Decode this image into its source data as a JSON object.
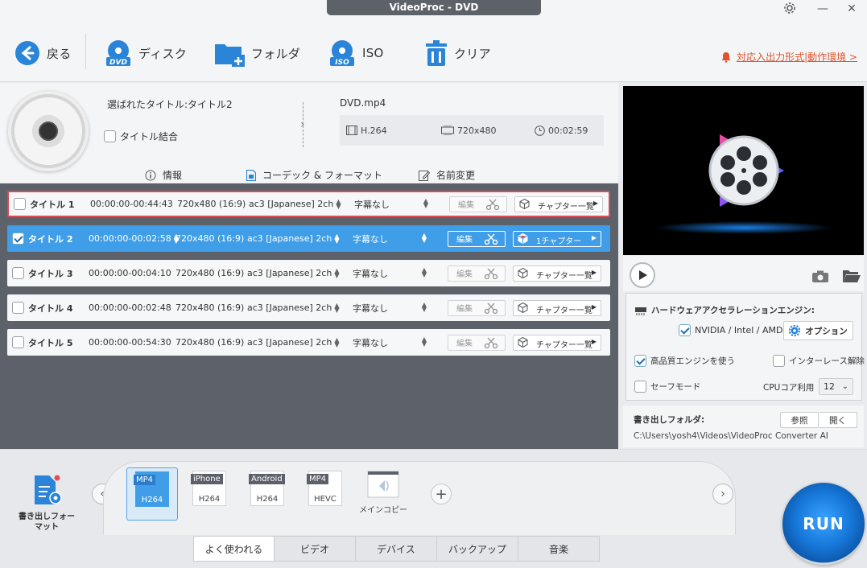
{
  "window": {
    "title": "VideoProc - DVD"
  },
  "toolbar": {
    "back": "戻る",
    "disc": "ディスク",
    "folder": "フォルダ",
    "iso": "ISO",
    "clear": "クリア",
    "link": "対応入出力形式|動作環境 >"
  },
  "info": {
    "selected_title": "選ばれたタイトル:タイトル2",
    "merge": "タイトル結合",
    "output_name": "DVD.mp4",
    "codec": "H.264",
    "resolution": "720x480",
    "duration": "00:02:59",
    "tabs": {
      "info": "情報",
      "codec": "コーデック & フォーマット",
      "rename": "名前変更"
    }
  },
  "titles": [
    {
      "name": "タイトル 1",
      "time": "00:00:00-00:44:43",
      "res": "720x480 (16:9)",
      "audio": "ac3 [Japanese] 2ch",
      "sub": "字幕なし",
      "edit": "編集",
      "chapter": "チャプター一覧",
      "checked": false
    },
    {
      "name": "タイトル 2",
      "time": "00:00:00-00:02:58",
      "res": "720x480 (16:9)",
      "audio": "ac3 [Japanese] 2ch",
      "sub": "字幕なし",
      "edit": "編集",
      "chapter": "1チャプター",
      "checked": true
    },
    {
      "name": "タイトル 3",
      "time": "00:00:00-00:04:10",
      "res": "720x480 (16:9)",
      "audio": "ac3 [Japanese] 2ch",
      "sub": "字幕なし",
      "edit": "編集",
      "chapter": "チャプター一覧",
      "checked": false
    },
    {
      "name": "タイトル 4",
      "time": "00:00:00-00:02:48",
      "res": "720x480 (16:9)",
      "audio": "ac3 [Japanese] 2ch",
      "sub": "字幕なし",
      "edit": "編集",
      "chapter": "チャプター一覧",
      "checked": false
    },
    {
      "name": "タイトル 5",
      "time": "00:00:00-00:54:30",
      "res": "720x480 (16:9)",
      "audio": "ac3 [Japanese] 2ch",
      "sub": "字幕なし",
      "edit": "編集",
      "chapter": "チャプター一覧",
      "checked": false
    }
  ],
  "settings": {
    "hw_title": "ハードウェアアクセラレーションエンジン:",
    "hw_vendor": "NVIDIA / Intel / AMD",
    "option": "オプション",
    "hq_engine": "高品質エンジンを使う",
    "deinterlace": "インターレース解除",
    "safe_mode": "セーフモード",
    "cpu_label": "CPUコア利用",
    "cpu_value": "12"
  },
  "output_folder": {
    "label": "書き出しフォルダ:",
    "browse": "参照",
    "open": "開く",
    "path": "C:\\Users\\yosh4\\Videos\\VideoProc Converter AI"
  },
  "bottom": {
    "export_format": "書き出しフォーマット",
    "formats": [
      {
        "top": "MP4",
        "bottom": "H264"
      },
      {
        "top": "iPhone",
        "bottom": "H264"
      },
      {
        "top": "Android",
        "bottom": "H264"
      },
      {
        "top": "MP4",
        "bottom": "HEVC"
      }
    ],
    "main_copy": "メインコピー",
    "tabs": [
      "よく使われる",
      "ビデオ",
      "デバイス",
      "バックアップ",
      "音楽"
    ],
    "run": "RUN"
  },
  "colors": {
    "accent": "#3f9ee7",
    "run": "#1677d9",
    "link": "#e0552d",
    "highlight_border": "#d84b57"
  }
}
